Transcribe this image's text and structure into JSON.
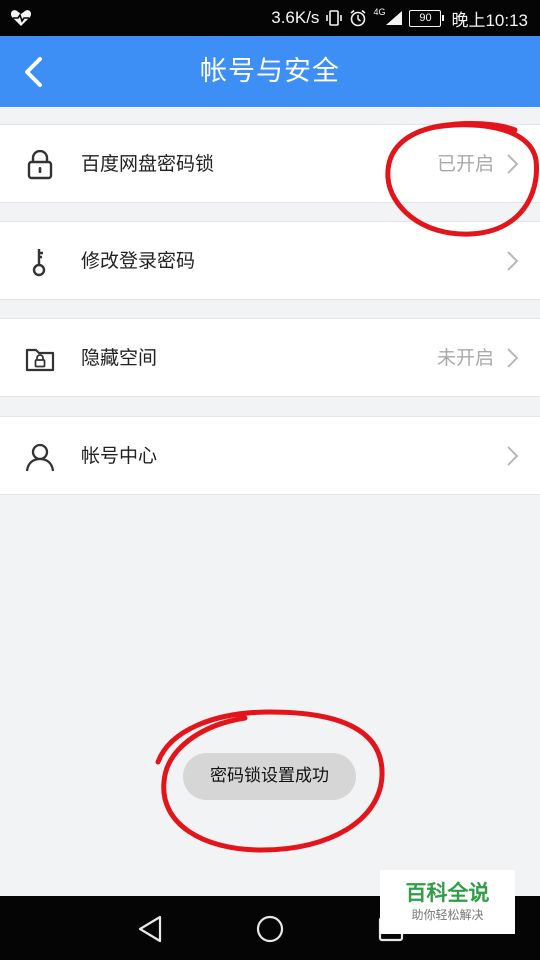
{
  "status_bar": {
    "speed": "3.6K/s",
    "network": "4G",
    "battery": "90",
    "time": "晚上10:13"
  },
  "header": {
    "title": "帐号与安全",
    "back_icon": "chevron-left-icon"
  },
  "settings": [
    {
      "label": "百度网盘密码锁",
      "value": "已开启",
      "icon": "lock-icon"
    },
    {
      "label": "修改登录密码",
      "value": "",
      "icon": "key-icon"
    },
    {
      "label": "隐藏空间",
      "value": "未开启",
      "icon": "locked-folder-icon"
    },
    {
      "label": "帐号中心",
      "value": "",
      "icon": "user-icon"
    }
  ],
  "toast": {
    "text": "密码锁设置成功"
  },
  "watermark": {
    "title": "百科全说",
    "subtitle": "助你轻松解决"
  },
  "colors": {
    "header": "#3d8ef5",
    "annotation": "#e3141a",
    "watermark": "#2f9e44"
  }
}
